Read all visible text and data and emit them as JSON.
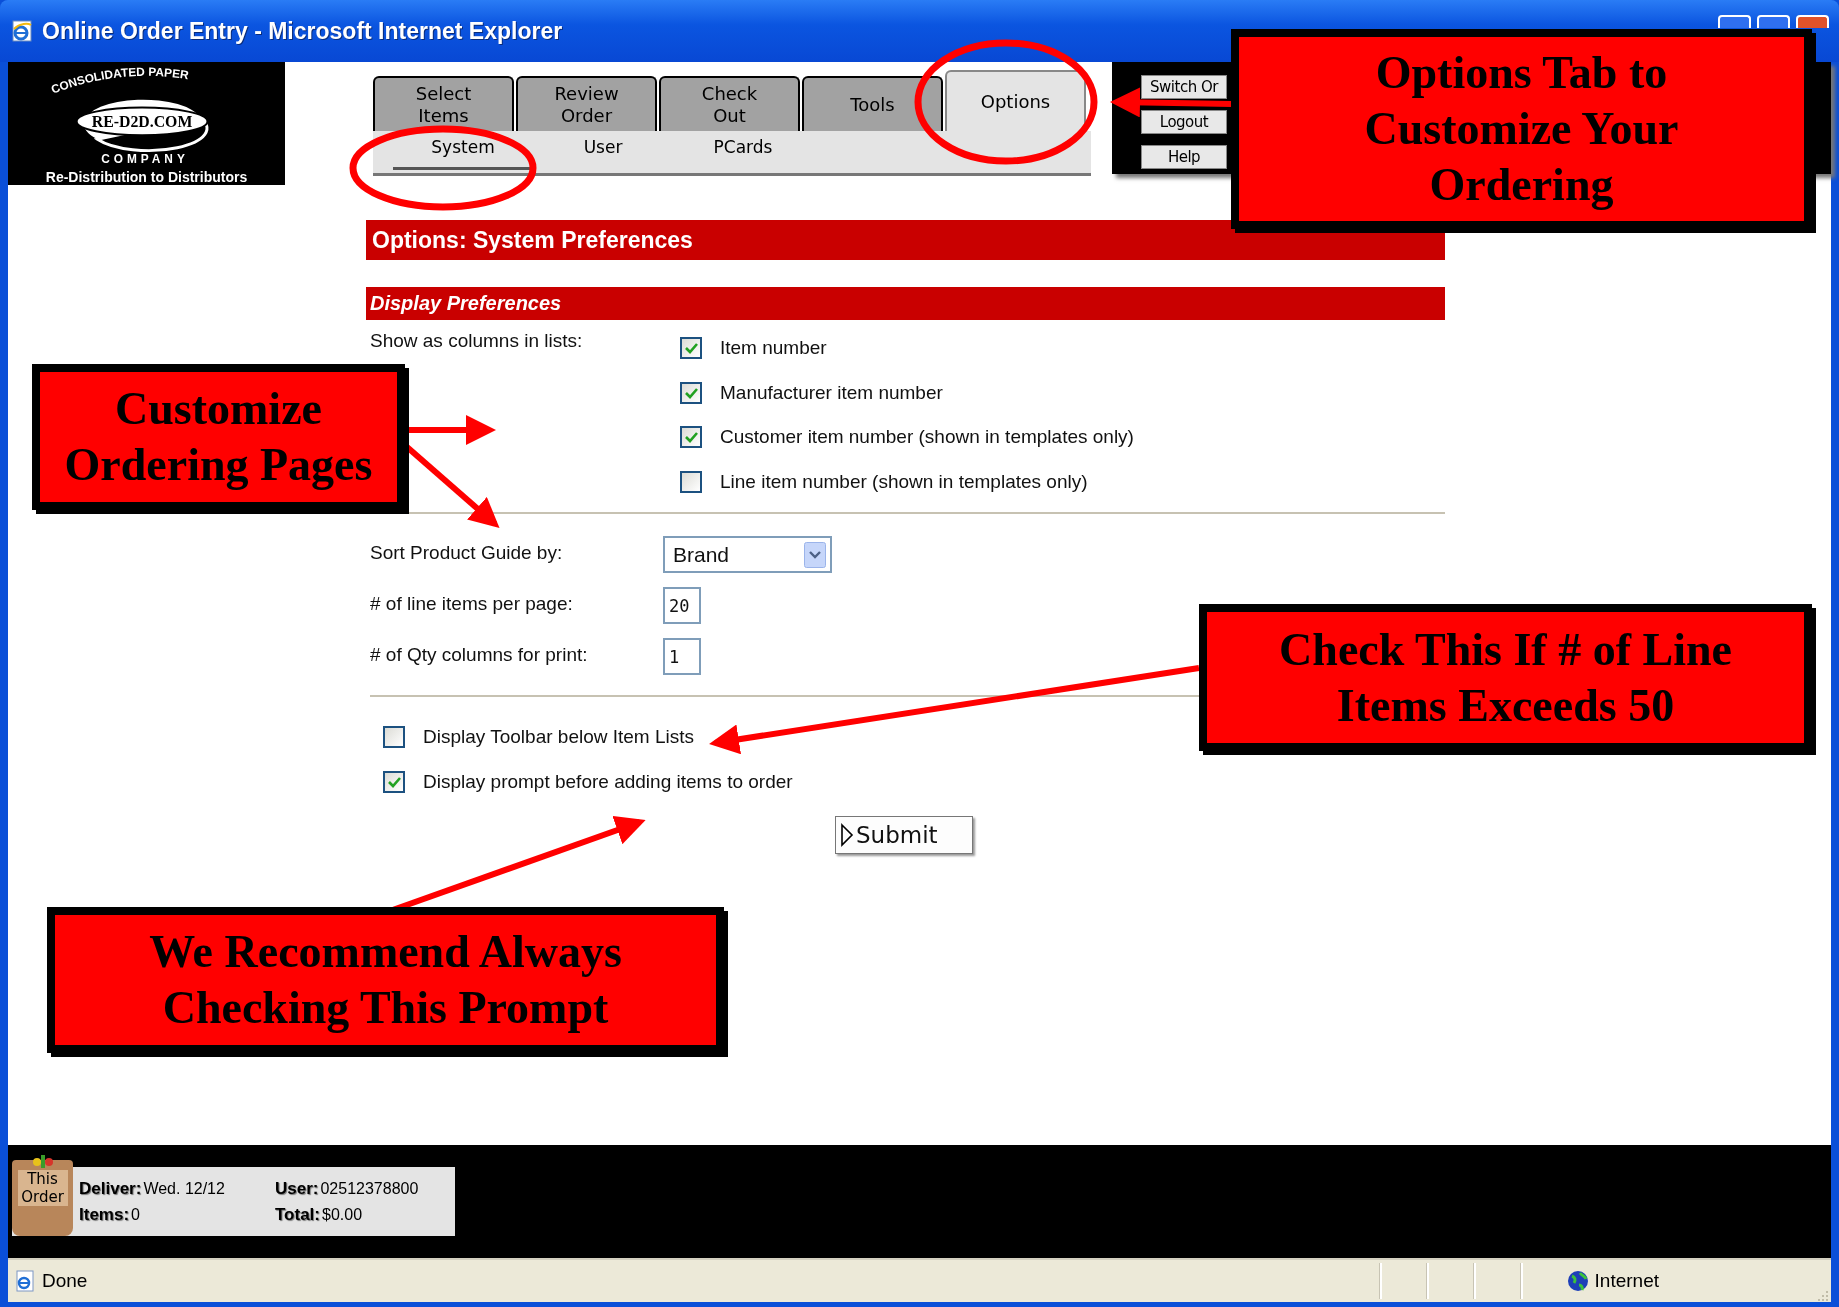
{
  "window": {
    "title": "Online Order Entry - Microsoft Internet Explorer"
  },
  "logo": {
    "arc_text": "CONSOLIDATED PAPER",
    "wordmark": "RE-D2D.COM",
    "bottom_text": "COMPANY",
    "tagline": "Re-Distribution to Distributors"
  },
  "tabs": [
    {
      "label": "Select\nItems",
      "selected": false
    },
    {
      "label": "Review\nOrder",
      "selected": false
    },
    {
      "label": "Check\nOut",
      "selected": false
    },
    {
      "label": "Tools",
      "selected": false
    },
    {
      "label": "Options",
      "selected": true
    }
  ],
  "subtabs": [
    {
      "label": "System",
      "selected": true
    },
    {
      "label": "User",
      "selected": false
    },
    {
      "label": "PCards",
      "selected": false
    }
  ],
  "header_buttons": [
    "Switch Or",
    "Logout",
    "Help"
  ],
  "page_title": "Options: System Preferences",
  "section_title": "Display Preferences",
  "columns_label": "Show as columns in lists:",
  "column_options": [
    {
      "label": "Item number",
      "checked": true
    },
    {
      "label": "Manufacturer item number",
      "checked": true
    },
    {
      "label": "Customer item number (shown in templates only)",
      "checked": true
    },
    {
      "label": "Line item number (shown in templates only)",
      "checked": false
    }
  ],
  "settings": [
    {
      "kind": "select",
      "label": "Sort Product Guide by:",
      "value": "Brand"
    },
    {
      "kind": "input",
      "label": "# of line items per page:",
      "value": "20"
    },
    {
      "kind": "input",
      "label": "# of Qty columns for print:",
      "value": "1"
    }
  ],
  "toggles": [
    {
      "label": "Display Toolbar below Item Lists",
      "checked": false
    },
    {
      "label": "Display prompt before adding items to order",
      "checked": true
    }
  ],
  "submit": "Submit",
  "order_summary": {
    "badge": "This Order",
    "deliver_label": "Deliver:",
    "deliver": "Wed. 12/12",
    "items_label": "Items:",
    "items": "0",
    "user_label": "User:",
    "user": "02512378800",
    "total_label": "Total:",
    "total": "$0.00"
  },
  "status_bar": {
    "text": "Done",
    "zone": "Internet"
  },
  "annotations": [
    {
      "text": "Options Tab to\nCustomize Your\nOrdering"
    },
    {
      "text": "Customize\nOrdering Pages"
    },
    {
      "text": "Check This If # of Line\nItems Exceeds 50"
    },
    {
      "text": "We Recommend Always\nChecking This Prompt"
    }
  ]
}
